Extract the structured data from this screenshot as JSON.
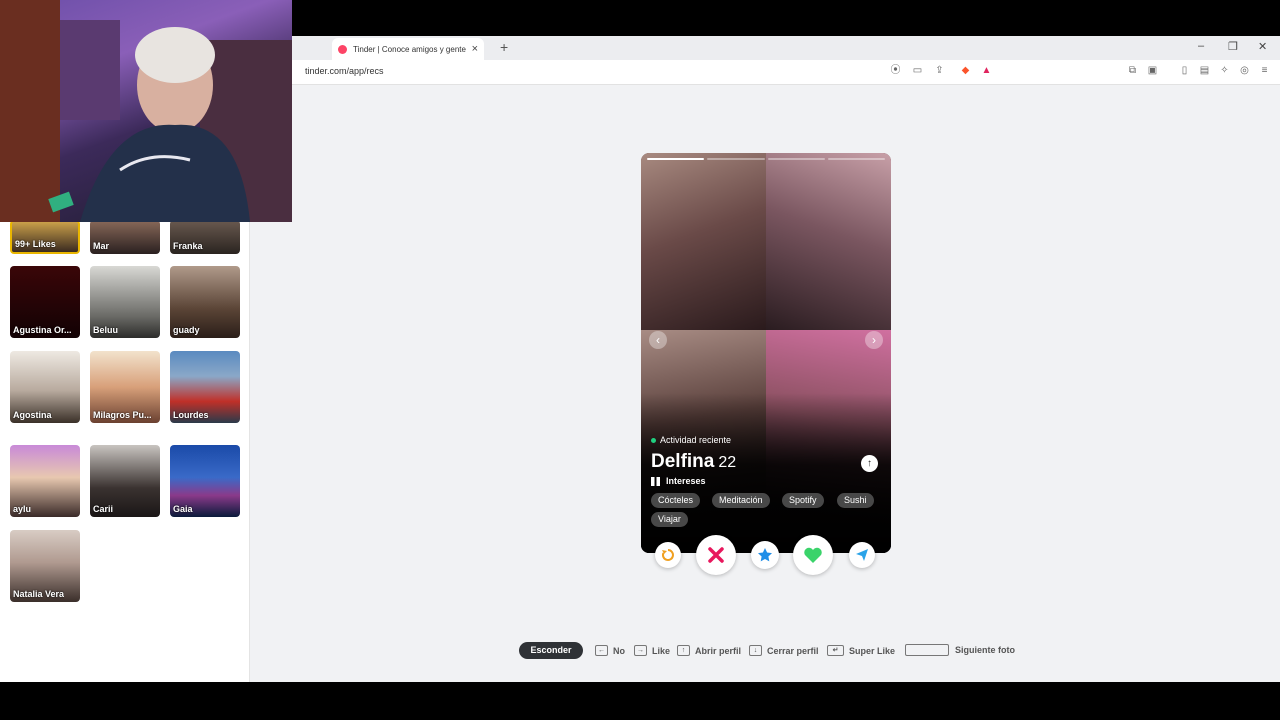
{
  "browser": {
    "tab_title": "Tinder | Conoce amigos y gente",
    "new_tab_label": "+",
    "url": "tinder.com/app/recs",
    "win_minimize": "–",
    "win_restore": "❐",
    "win_close": "✕"
  },
  "sidebar": {
    "tiles": [
      {
        "name": "99+ Likes"
      },
      {
        "name": "Mar"
      },
      {
        "name": "Franka"
      },
      {
        "name": "Agustina Or..."
      },
      {
        "name": "Beluu"
      },
      {
        "name": "guady"
      },
      {
        "name": "Agostina"
      },
      {
        "name": "Milagros Pu..."
      },
      {
        "name": "Lourdes"
      },
      {
        "name": "aylu"
      },
      {
        "name": "Carii"
      },
      {
        "name": "Gaia"
      },
      {
        "name": "Natalia Vera"
      }
    ]
  },
  "card": {
    "photo_count": 4,
    "activity": "Actividad reciente",
    "name": "Delfina",
    "age": "22",
    "interests_label": "Intereses",
    "interests": [
      "Cócteles",
      "Meditación",
      "Spotify",
      "Sushi",
      "Viajar"
    ]
  },
  "actions": {
    "rewind_icon": "rewind-icon",
    "nope_icon": "x-icon",
    "superlike_icon": "star-icon",
    "like_icon": "heart-icon",
    "boost_icon": "send-icon",
    "colors": {
      "nope": "#e8175d",
      "superlike": "#1f8ee8",
      "like": "#3ad36a",
      "rewind": "#f0a020",
      "boost": "#2aa3e8"
    }
  },
  "shortcuts": {
    "hide": "Esconder",
    "no": "No",
    "like": "Like",
    "open_profile": "Abrir perfil",
    "close_profile": "Cerrar perfil",
    "super_like": "Super Like",
    "next_photo": "Siguiente foto"
  }
}
